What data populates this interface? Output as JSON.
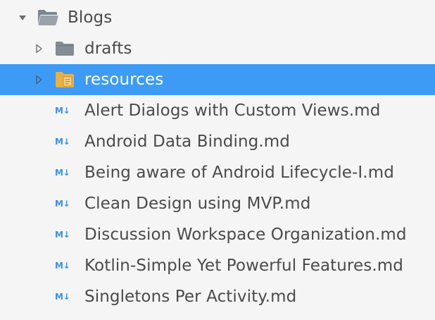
{
  "tree": {
    "root": {
      "label": "Blogs",
      "expanded": true,
      "icon": "folder-open-icon"
    },
    "folders": [
      {
        "label": "drafts",
        "icon": "folder-icon",
        "expanded": false,
        "selected": false
      },
      {
        "label": "resources",
        "icon": "folder-resources-icon",
        "expanded": false,
        "selected": true
      }
    ],
    "files": [
      {
        "label": "Alert Dialogs with Custom Views.md",
        "icon": "markdown-icon"
      },
      {
        "label": "Android Data Binding.md",
        "icon": "markdown-icon"
      },
      {
        "label": "Being aware of Android Lifecycle-I.md",
        "icon": "markdown-icon"
      },
      {
        "label": "Clean Design using MVP.md",
        "icon": "markdown-icon"
      },
      {
        "label": "Discussion Workspace Organization.md",
        "icon": "markdown-icon"
      },
      {
        "label": "Kotlin-Simple Yet Powerful Features.md",
        "icon": "markdown-icon"
      },
      {
        "label": "Singletons Per Activity.md",
        "icon": "markdown-icon"
      }
    ],
    "markdown_icon_text": "M↓"
  },
  "colors": {
    "background": "#f5f5f5",
    "selection": "#3d9bf5",
    "text": "#4a4a4a",
    "folder": "#8a9199",
    "resources_folder": "#e8b04a",
    "markdown_icon": "#3b8fe8"
  }
}
